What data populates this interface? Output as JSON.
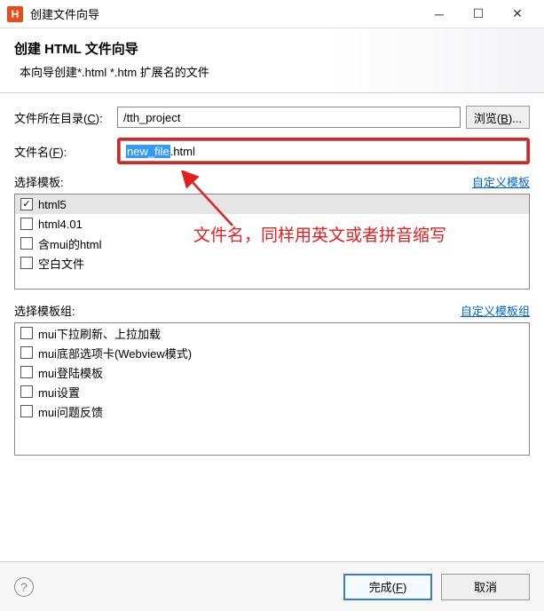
{
  "titlebar": {
    "icon_letter": "H",
    "title": "创建文件向导"
  },
  "header": {
    "title": "创建 HTML 文件向导",
    "description": "本向导创建*.html *.htm 扩展名的文件"
  },
  "form": {
    "dir_label_pre": "文件所在目录(",
    "dir_label_key": "C",
    "dir_label_post": "):",
    "dir_value": "/tth_project",
    "browse_pre": "浏览(",
    "browse_key": "B",
    "browse_post": ")...",
    "file_label_pre": "文件名(",
    "file_label_key": "F",
    "file_label_post": "):",
    "file_selected": "new_file",
    "file_suffix": ".html"
  },
  "templates": {
    "label": "选择模板:",
    "custom_link": "自定义模板",
    "items": [
      {
        "label": "html5",
        "checked": true
      },
      {
        "label": "html4.01",
        "checked": false
      },
      {
        "label": "含mui的html",
        "checked": false
      },
      {
        "label": "空白文件",
        "checked": false
      }
    ]
  },
  "template_groups": {
    "label": "选择模板组:",
    "custom_link": "自定义模板组",
    "items": [
      {
        "label": "mui下拉刷新、上拉加载"
      },
      {
        "label": "mui底部选项卡(Webview模式)"
      },
      {
        "label": "mui登陆模板"
      },
      {
        "label": "mui设置"
      },
      {
        "label": "mui问题反馈"
      }
    ]
  },
  "annotation": {
    "text": "文件名，同样用英文或者拼音缩写"
  },
  "footer": {
    "help": "?",
    "finish_pre": "完成(",
    "finish_key": "F",
    "finish_post": ")",
    "cancel": "取消"
  }
}
